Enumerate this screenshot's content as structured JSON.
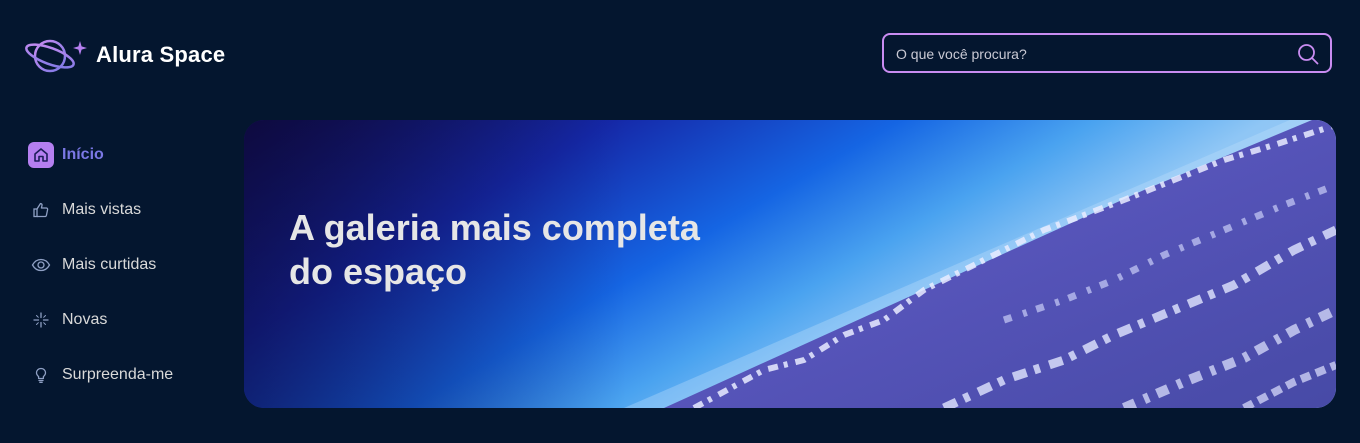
{
  "header": {
    "logo_text": "Alura Space",
    "logo_icon": "planet-icon",
    "search": {
      "placeholder": "O que você procura?",
      "value": "",
      "icon": "search-icon"
    }
  },
  "sidebar": {
    "items": [
      {
        "label": "Início",
        "icon": "home-icon",
        "active": true
      },
      {
        "label": "Mais vistas",
        "icon": "thumbs-up-icon",
        "active": false
      },
      {
        "label": "Mais curtidas",
        "icon": "eye-icon",
        "active": false
      },
      {
        "label": "Novas",
        "icon": "sparkle-icon",
        "active": false
      },
      {
        "label": "Surpreenda-me",
        "icon": "lightbulb-icon",
        "active": false
      }
    ]
  },
  "banner": {
    "title": "A galeria mais completa do espaço"
  },
  "colors": {
    "background": "#04162f",
    "accent": "#c98cf1",
    "active_text": "#7b78e5",
    "text": "#d9d9d9"
  }
}
